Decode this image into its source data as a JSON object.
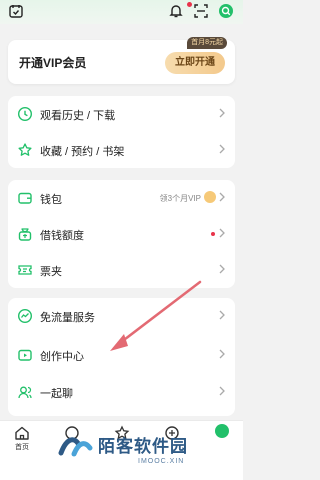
{
  "vip": {
    "title": "开通VIP会员",
    "badge": "首月8元起",
    "button": "立即开通"
  },
  "menu_group_1": [
    {
      "label": "观看历史 / 下载",
      "icon": "clock-icon"
    },
    {
      "label": "收藏 / 预约 / 书架",
      "icon": "star-icon"
    }
  ],
  "menu_group_2": [
    {
      "label": "钱包",
      "icon": "wallet-icon",
      "sub": "领3个月VIP"
    },
    {
      "label": "借钱额度",
      "icon": "money-bag-icon"
    },
    {
      "label": "票夹",
      "icon": "ticket-icon"
    }
  ],
  "menu_group_3": [
    {
      "label": "免流量服务",
      "icon": "free-data-icon"
    },
    {
      "label": "创作中心",
      "icon": "tv-icon"
    },
    {
      "label": "一起聊",
      "icon": "people-icon"
    }
  ],
  "bottom_tabs": [
    {
      "label": "首页",
      "icon": "home-icon"
    }
  ],
  "watermark": {
    "text": "陌客软件园",
    "url": "IMOOC.XIN"
  },
  "colors": {
    "accent": "#22c06a",
    "vip_gold": "#f3c98c",
    "arrow": "#e36a73",
    "red_dot": "#e8334a"
  }
}
